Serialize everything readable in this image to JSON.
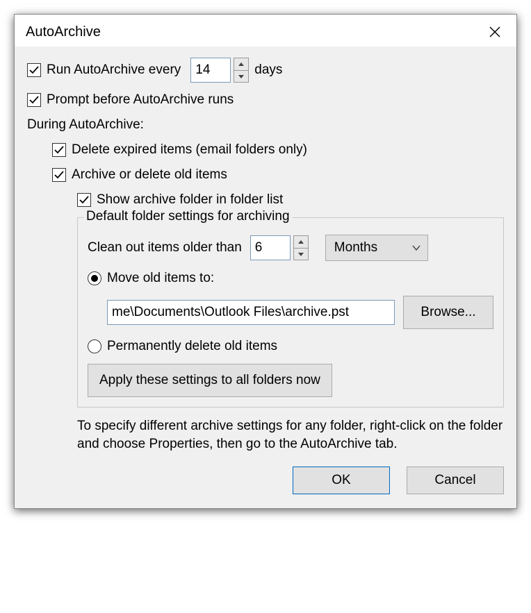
{
  "title": "AutoArchive",
  "run_every": {
    "checked": true,
    "label_left": "Run AutoArchive every",
    "value": "14",
    "label_right": "days"
  },
  "prompt": {
    "checked": true,
    "label": "Prompt before AutoArchive runs"
  },
  "during_label": "During AutoArchive:",
  "delete_expired": {
    "checked": true,
    "label": "Delete expired items (email folders only)"
  },
  "archive_old": {
    "checked": true,
    "label": "Archive or delete old items"
  },
  "show_folder": {
    "checked": true,
    "label": "Show archive folder in folder list"
  },
  "fieldset": {
    "legend": "Default folder settings for archiving",
    "clean_label": "Clean out items older than",
    "clean_value": "6",
    "unit_selected": "Months",
    "move_option": {
      "selected": true,
      "label": "Move old items to:",
      "path": "me\\Documents\\Outlook Files\\archive.pst",
      "browse_label": "Browse..."
    },
    "delete_option": {
      "selected": false,
      "label": "Permanently delete old items"
    },
    "apply_button": "Apply these settings to all folders now"
  },
  "hint": "To specify different archive settings for any folder, right-click on the folder and choose Properties, then go to the AutoArchive tab.",
  "buttons": {
    "ok": "OK",
    "cancel": "Cancel"
  }
}
